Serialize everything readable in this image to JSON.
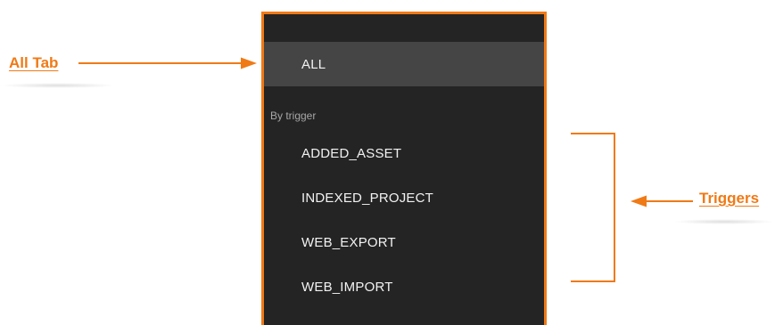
{
  "annotations": {
    "all_tab_label": "All Tab",
    "triggers_label": "Triggers",
    "accent_color": "#f07a16"
  },
  "menu": {
    "all_item": "ALL",
    "section_label": "By trigger",
    "triggers": [
      "ADDED_ASSET",
      "INDEXED_PROJECT",
      "WEB_EXPORT",
      "WEB_IMPORT"
    ]
  }
}
